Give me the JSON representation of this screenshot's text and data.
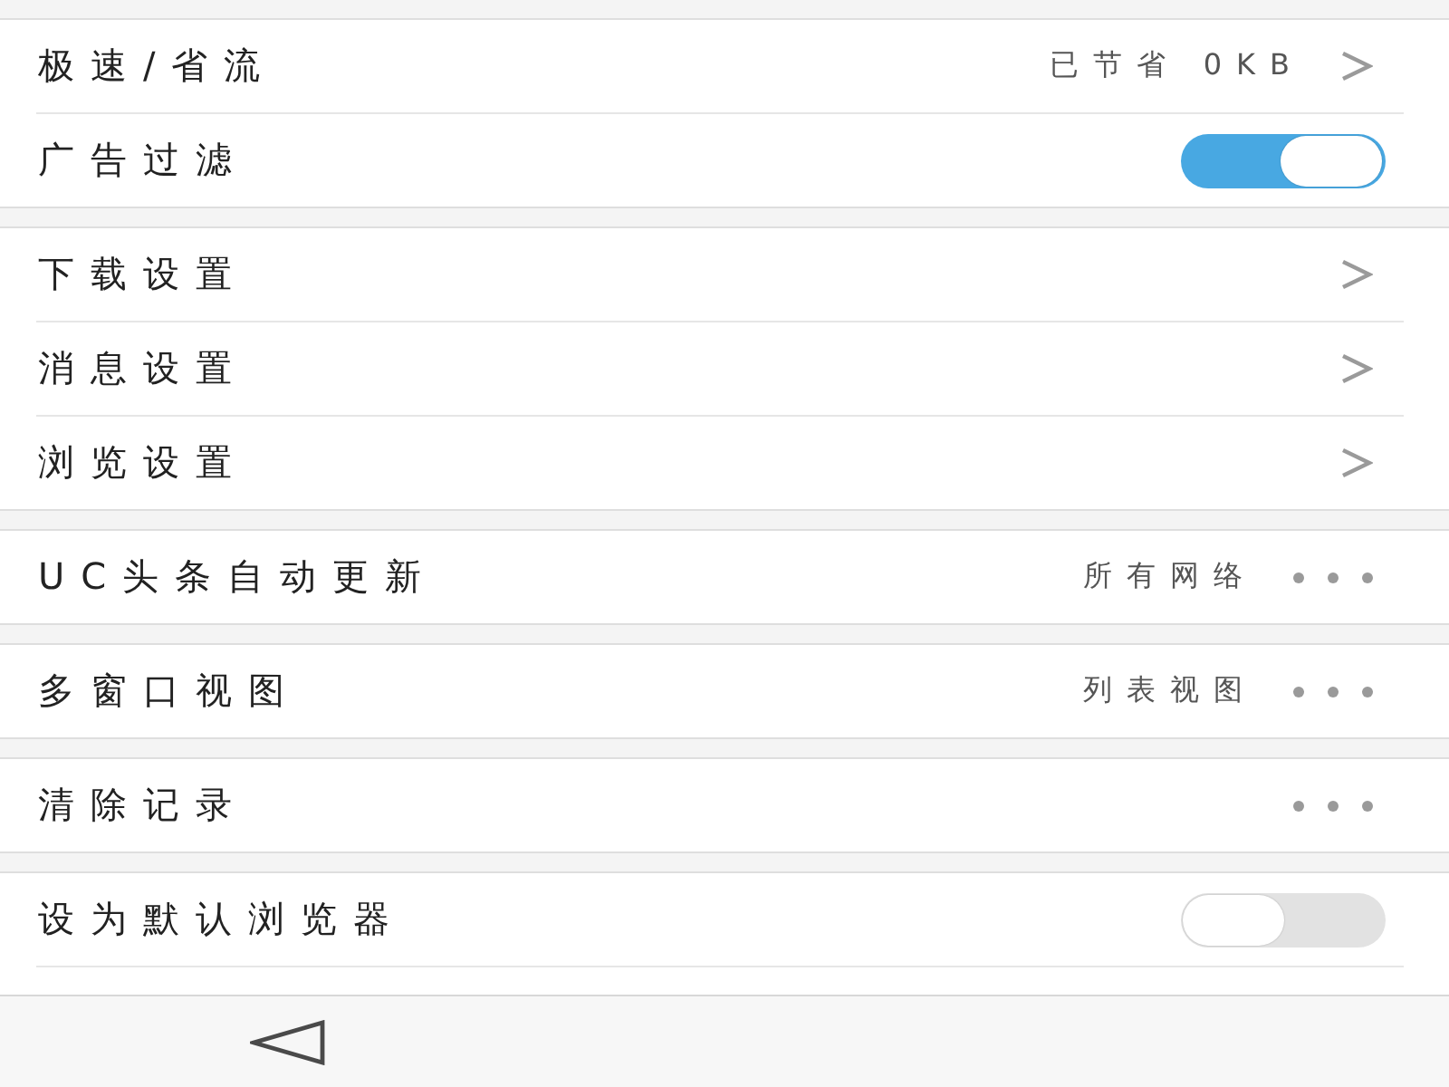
{
  "groups": [
    {
      "items": [
        {
          "kind": "link",
          "label": "极速/省流",
          "value": "已节省 0KB"
        },
        {
          "kind": "switch",
          "label": "广告过滤",
          "on": true
        }
      ]
    },
    {
      "items": [
        {
          "kind": "link",
          "label": "下载设置"
        },
        {
          "kind": "link",
          "label": "消息设置"
        },
        {
          "kind": "link",
          "label": "浏览设置"
        }
      ]
    },
    {
      "items": [
        {
          "kind": "menu",
          "label": "UC头条自动更新",
          "value": "所有网络"
        }
      ]
    },
    {
      "items": [
        {
          "kind": "menu",
          "label": "多窗口视图",
          "value": "列表视图"
        }
      ]
    },
    {
      "items": [
        {
          "kind": "menu",
          "label": "清除记录"
        }
      ]
    },
    {
      "items": [
        {
          "kind": "switch",
          "label": "设为默认浏览器",
          "on": false
        }
      ]
    }
  ],
  "nav_bar": {
    "buttons": [
      {
        "kind": "back"
      }
    ]
  }
}
